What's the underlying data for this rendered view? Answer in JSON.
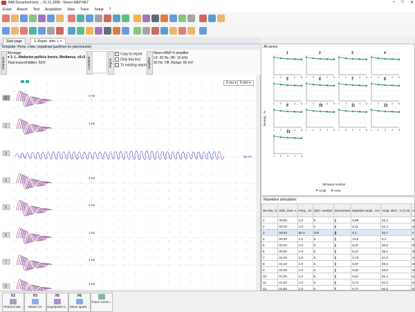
{
  "window": {
    "title": "NMI Document-test, -, 01.11.2006 - Neuro-MEP.NET",
    "controls": [
      "–",
      "□",
      "✕"
    ]
  },
  "menu": [
    "Exam",
    "Report",
    "Test",
    "Acquisition",
    "View",
    "Trace",
    "Setup",
    "?"
  ],
  "tabs": [
    "Start page",
    "1. Repet. stim. L"
  ],
  "template": "Template: Ритм. стим. серийная [шаблон по умолчанию]",
  "info": {
    "channels_tab": "Channels",
    "montage_label": "Montage",
    "montage_value": "1: L. Abductor pollicis brevis, Medianus, c6-t1",
    "total_traces": "Total traces/hidden: 50/0",
    "comment_tab": "Comment",
    "report_tab": "Report",
    "copy_to_report": "Copy to report",
    "only_this_test": "Only this test",
    "to_existing_report": "To existing report",
    "amplifier_tab": "Amplifier",
    "amp_title": "Neuro-MEP-4 amplifier",
    "amp_line1": "LF: 20 Hz, HF: 10 kHz",
    "amp_line2": "50 Hz: Off, Range: 60 mV"
  },
  "traces": {
    "scale_time": "5 ms",
    "scale_amp": "5 mV",
    "sweep_rate": "50 Hz",
    "marker_label": "1 Hz",
    "rows": [
      "1",
      "2",
      "3",
      "4",
      "5",
      "6",
      "7",
      "8"
    ]
  },
  "all_series": {
    "title": "All series",
    "ylabel": "M-resp., %",
    "xlabel": "Stimulus number",
    "legend": [
      "Ampl.",
      "Area"
    ],
    "panels": [
      "1",
      "2",
      "3",
      "4",
      "5",
      "6",
      "7",
      "8",
      "9",
      "10",
      "11",
      "12",
      "13"
    ]
  },
  "chart_data": {
    "type": "line",
    "x": [
      1,
      2,
      3,
      4,
      5
    ],
    "ylim": [
      0,
      100
    ],
    "series": [
      {
        "name": "Ampl.",
        "values": [
          100,
          93,
          90,
          88,
          86
        ]
      },
      {
        "name": "Area",
        "values": [
          100,
          95,
          92,
          91,
          90
        ]
      }
    ]
  },
  "rep_table": {
    "title": "Repetitive stimulation",
    "headers": [
      "Se-ries, N",
      "Stim. time, s",
      "Freq., Hz",
      "Stim. number",
      "Decrement",
      "Baseline ampl., mV",
      "Ampl. decr., % (1-5)",
      "Ampl. decr., % (1-last)",
      "Baseline area, mV·ms",
      "Area decr., % (1-5)",
      "Area decr., % (1-last)",
      "Stim., mA",
      "Stim., ms"
    ],
    "rows": [
      [
        "1",
        "00:00",
        "1.0",
        "5",
        "",
        "6,98",
        "42,4",
        "45,1",
        "16,4",
        "41,6",
        "41,6",
        "30",
        "0,1"
      ],
      [
        "2",
        "00:10",
        "1.0",
        "5",
        "",
        "6,11",
        "42,4",
        "42,4",
        "15,8",
        "43,5",
        "43,5",
        "30",
        "0,1"
      ],
      [
        "3",
        "00:20",
        "50.0",
        "200",
        "",
        "6,1",
        "22,7",
        "+83,6",
        "15,7",
        "34,4",
        "+17,1",
        "30",
        "0,1"
      ],
      [
        "4",
        "00:30",
        "1.0",
        "5",
        "",
        "10,5",
        "8,1",
        "8,1",
        "22,0",
        "2,5",
        "2,5",
        "30",
        "0,1"
      ],
      [
        "5",
        "00:40",
        "1.0",
        "5",
        "",
        "8,37",
        "36,5",
        "36,5",
        "21,6",
        "35,2",
        "35,2",
        "30",
        "0,1"
      ],
      [
        "6",
        "00:50",
        "1.0",
        "5",
        "",
        "8,47",
        "38,1",
        "38,1",
        "22,2",
        "36,8",
        "36,8",
        "30",
        "0,1"
      ],
      [
        "7",
        "01:00",
        "1.0",
        "5",
        "",
        "6,73",
        "47,9",
        "47,9",
        "17,2",
        "44,8",
        "44,8",
        "30",
        "0,1"
      ],
      [
        "8",
        "01:10",
        "1.0",
        "5",
        "",
        "5,97",
        "49,4",
        "49,4",
        "16,3",
        "48,2",
        "48,2",
        "30",
        "0,1"
      ],
      [
        "9",
        "01:20",
        "1.0",
        "5",
        "",
        "5,81",
        "48,8",
        "48,8",
        "16,1",
        "48,0",
        "48,0",
        "30",
        "0,1"
      ],
      [
        "10",
        "01:30",
        "1.0",
        "5",
        "",
        "5,81",
        "51,4",
        "51,4",
        "16,0",
        "47,6",
        "47,6",
        "30",
        "0,1"
      ],
      [
        "11",
        "01:40",
        "1.0",
        "5",
        "",
        "5,74",
        "51,0",
        "51,0",
        "16,1",
        "47,7",
        "47,7",
        "30",
        "0,1"
      ],
      [
        "12",
        "01:50",
        "1.0",
        "5",
        "",
        "5,77",
        "51,0",
        "51,0",
        "16,0",
        "48,0",
        "48,0",
        "30",
        "0,1"
      ]
    ]
  },
  "fkeys": [
    {
      "key": "F2",
      "label": "Protocol set..."
    },
    {
      "key": "F3",
      "label": "Motor CV"
    },
    {
      "key": "F5",
      "label": "Superpose h..."
    },
    {
      "key": "F6",
      "label": "Move apart/..."
    },
    {
      "key": "",
      "label": "Trace comm..."
    }
  ],
  "colors": {
    "trace_blue": "#2233bb",
    "trace_red": "#c0304a",
    "trace_purple": "#7a3a9a",
    "chart_line": "#2e8b7a",
    "accent": "#3a7bd5"
  }
}
